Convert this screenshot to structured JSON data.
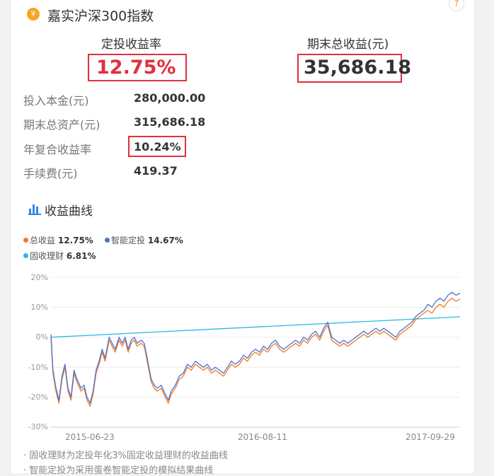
{
  "header": {
    "title": "嘉实沪深300指数",
    "icon": "¥",
    "help": "?"
  },
  "summary": {
    "rate_label": "定投收益率",
    "rate_value": "12.75%",
    "profit_label": "期末总收益(元)",
    "profit_value": "35,686.18"
  },
  "details": [
    {
      "label": "投入本金(元)",
      "value": "280,000.00"
    },
    {
      "label": "期末总资产(元)",
      "value": "315,686.18"
    },
    {
      "label": "年复合收益率",
      "value": "10.24%"
    },
    {
      "label": "手续费(元)",
      "value": "419.37"
    }
  ],
  "section": {
    "title": "收益曲线",
    "icon": "bar-chart-icon"
  },
  "legend": [
    {
      "name": "总收益",
      "value": "12.75%",
      "color": "#f5791f"
    },
    {
      "name": "智能定投",
      "value": "14.67%",
      "color": "#4a73d6"
    },
    {
      "name": "固收理财",
      "value": "6.81%",
      "color": "#2bb8e8"
    }
  ],
  "chart_data": {
    "type": "line",
    "yticks": [
      "20%",
      "10%",
      "0%",
      "-10%",
      "-20%",
      "-30%"
    ],
    "xticks": [
      "2015-06-23",
      "2016-08-11",
      "2017-09-29"
    ],
    "ylim": [
      -30,
      20
    ],
    "series": [
      {
        "name": "总收益",
        "color": "#f5791f",
        "points": [
          [
            0,
            0
          ],
          [
            0.2,
            -12
          ],
          [
            0.5,
            -18
          ],
          [
            0.8,
            -22
          ],
          [
            1.1,
            -14
          ],
          [
            1.4,
            -10
          ],
          [
            1.7,
            -18
          ],
          [
            2,
            -21
          ],
          [
            2.3,
            -12
          ],
          [
            2.6,
            -15
          ],
          [
            3,
            -18
          ],
          [
            3.3,
            -17
          ],
          [
            3.6,
            -21
          ],
          [
            3.9,
            -23
          ],
          [
            4.2,
            -19
          ],
          [
            4.5,
            -12
          ],
          [
            4.8,
            -9
          ],
          [
            5.1,
            -5
          ],
          [
            5.4,
            -8
          ],
          [
            5.8,
            -1
          ],
          [
            6.1,
            -3
          ],
          [
            6.4,
            -5
          ],
          [
            6.8,
            -1
          ],
          [
            7.1,
            -3
          ],
          [
            7.4,
            -1
          ],
          [
            7.7,
            -5
          ],
          [
            8.0,
            -2
          ],
          [
            8.3,
            -1
          ],
          [
            8.6,
            -3
          ],
          [
            9,
            -2
          ],
          [
            9.3,
            -3
          ],
          [
            9.6,
            -8
          ],
          [
            10,
            -15
          ],
          [
            10.3,
            -17
          ],
          [
            10.6,
            -18
          ],
          [
            11,
            -17
          ],
          [
            11.4,
            -20
          ],
          [
            11.7,
            -22
          ],
          [
            12,
            -19
          ],
          [
            12.4,
            -17
          ],
          [
            12.8,
            -14
          ],
          [
            13.2,
            -13
          ],
          [
            13.6,
            -10
          ],
          [
            14,
            -11
          ],
          [
            14.4,
            -9
          ],
          [
            14.8,
            -10
          ],
          [
            15.2,
            -11
          ],
          [
            15.6,
            -10
          ],
          [
            16,
            -12
          ],
          [
            16.4,
            -11
          ],
          [
            16.8,
            -12
          ],
          [
            17.2,
            -13
          ],
          [
            17.6,
            -11
          ],
          [
            18,
            -9
          ],
          [
            18.4,
            -10
          ],
          [
            18.8,
            -9
          ],
          [
            19.2,
            -7
          ],
          [
            19.6,
            -8
          ],
          [
            20,
            -6
          ],
          [
            20.4,
            -5
          ],
          [
            20.8,
            -6
          ],
          [
            21.2,
            -4
          ],
          [
            21.6,
            -5
          ],
          [
            22,
            -3
          ],
          [
            22.4,
            -2
          ],
          [
            22.8,
            -4
          ],
          [
            23.2,
            -5
          ],
          [
            23.6,
            -4
          ],
          [
            24,
            -3
          ],
          [
            24.4,
            -2
          ],
          [
            24.8,
            -3
          ],
          [
            25.2,
            -1
          ],
          [
            25.6,
            -2
          ],
          [
            26,
            0
          ],
          [
            26.4,
            1
          ],
          [
            26.8,
            -1
          ],
          [
            27.2,
            2
          ],
          [
            27.6,
            4
          ],
          [
            28,
            -1
          ],
          [
            28.4,
            -2
          ],
          [
            28.8,
            -3
          ],
          [
            29.2,
            -2
          ],
          [
            29.6,
            -3
          ],
          [
            30,
            -2
          ],
          [
            30.4,
            -1
          ],
          [
            30.8,
            0
          ],
          [
            31.2,
            1
          ],
          [
            31.6,
            0
          ],
          [
            32,
            1
          ],
          [
            32.4,
            2
          ],
          [
            32.8,
            1
          ],
          [
            33.2,
            2
          ],
          [
            33.6,
            1
          ],
          [
            34,
            0
          ],
          [
            34.4,
            -1
          ],
          [
            34.8,
            1
          ],
          [
            35.2,
            2
          ],
          [
            35.6,
            3
          ],
          [
            36,
            4
          ],
          [
            36.4,
            6
          ],
          [
            36.8,
            7
          ],
          [
            37.2,
            8
          ],
          [
            37.6,
            9
          ],
          [
            38,
            8
          ],
          [
            38.4,
            10
          ],
          [
            38.8,
            11
          ],
          [
            39.2,
            10
          ],
          [
            39.6,
            12
          ],
          [
            40,
            13
          ],
          [
            40.4,
            12
          ],
          [
            40.8,
            12.7
          ]
        ]
      },
      {
        "name": "智能定投",
        "color": "#4a73d6",
        "points": [
          [
            0,
            1
          ],
          [
            0.2,
            -11
          ],
          [
            0.5,
            -17
          ],
          [
            0.8,
            -21
          ],
          [
            1.1,
            -13
          ],
          [
            1.4,
            -9
          ],
          [
            1.7,
            -17
          ],
          [
            2,
            -20
          ],
          [
            2.3,
            -11
          ],
          [
            2.6,
            -14
          ],
          [
            3,
            -17
          ],
          [
            3.3,
            -16
          ],
          [
            3.6,
            -20
          ],
          [
            3.9,
            -22
          ],
          [
            4.2,
            -18
          ],
          [
            4.5,
            -11
          ],
          [
            4.8,
            -8
          ],
          [
            5.1,
            -4
          ],
          [
            5.4,
            -7
          ],
          [
            5.8,
            0
          ],
          [
            6.1,
            -2
          ],
          [
            6.4,
            -4
          ],
          [
            6.8,
            0
          ],
          [
            7.1,
            -2
          ],
          [
            7.4,
            0
          ],
          [
            7.7,
            -4
          ],
          [
            8.0,
            -1
          ],
          [
            8.3,
            0
          ],
          [
            8.6,
            -2
          ],
          [
            9,
            -1
          ],
          [
            9.3,
            -2
          ],
          [
            9.6,
            -7
          ],
          [
            10,
            -14
          ],
          [
            10.3,
            -16
          ],
          [
            10.6,
            -17
          ],
          [
            11,
            -16
          ],
          [
            11.4,
            -19
          ],
          [
            11.7,
            -21
          ],
          [
            12,
            -18
          ],
          [
            12.4,
            -16
          ],
          [
            12.8,
            -13
          ],
          [
            13.2,
            -12
          ],
          [
            13.6,
            -9
          ],
          [
            14,
            -10
          ],
          [
            14.4,
            -8
          ],
          [
            14.8,
            -9
          ],
          [
            15.2,
            -10
          ],
          [
            15.6,
            -9
          ],
          [
            16,
            -11
          ],
          [
            16.4,
            -10
          ],
          [
            16.8,
            -11
          ],
          [
            17.2,
            -12
          ],
          [
            17.6,
            -10
          ],
          [
            18,
            -8
          ],
          [
            18.4,
            -9
          ],
          [
            18.8,
            -8
          ],
          [
            19.2,
            -6
          ],
          [
            19.6,
            -7
          ],
          [
            20,
            -5
          ],
          [
            20.4,
            -4
          ],
          [
            20.8,
            -5
          ],
          [
            21.2,
            -3
          ],
          [
            21.6,
            -4
          ],
          [
            22,
            -2
          ],
          [
            22.4,
            -1
          ],
          [
            22.8,
            -3
          ],
          [
            23.2,
            -4
          ],
          [
            23.6,
            -3
          ],
          [
            24,
            -2
          ],
          [
            24.4,
            -1
          ],
          [
            24.8,
            -2
          ],
          [
            25.2,
            0
          ],
          [
            25.6,
            -1
          ],
          [
            26,
            1
          ],
          [
            26.4,
            2
          ],
          [
            26.8,
            0
          ],
          [
            27.2,
            3
          ],
          [
            27.6,
            5
          ],
          [
            28,
            0
          ],
          [
            28.4,
            -1
          ],
          [
            28.8,
            -2
          ],
          [
            29.2,
            -1
          ],
          [
            29.6,
            -2
          ],
          [
            30,
            -1
          ],
          [
            30.4,
            0
          ],
          [
            30.8,
            1
          ],
          [
            31.2,
            2
          ],
          [
            31.6,
            1
          ],
          [
            32,
            2
          ],
          [
            32.4,
            3
          ],
          [
            32.8,
            2
          ],
          [
            33.2,
            3
          ],
          [
            33.6,
            2
          ],
          [
            34,
            1
          ],
          [
            34.4,
            0
          ],
          [
            34.8,
            2
          ],
          [
            35.2,
            3
          ],
          [
            35.6,
            4
          ],
          [
            36,
            5
          ],
          [
            36.4,
            7
          ],
          [
            36.8,
            8
          ],
          [
            37.2,
            9
          ],
          [
            37.6,
            11
          ],
          [
            38,
            10
          ],
          [
            38.4,
            12
          ],
          [
            38.8,
            13
          ],
          [
            39.2,
            12
          ],
          [
            39.6,
            14
          ],
          [
            40,
            15
          ],
          [
            40.4,
            14
          ],
          [
            40.8,
            14.7
          ]
        ]
      },
      {
        "name": "固收理财",
        "color": "#2bb8e8",
        "points": [
          [
            0,
            0
          ],
          [
            40.8,
            6.81
          ]
        ]
      }
    ]
  },
  "notes": [
    "固收理财为定投年化3%固定收益理财的收益曲线",
    "智能定投为采用蛋卷智能定投的模拟结果曲线"
  ]
}
